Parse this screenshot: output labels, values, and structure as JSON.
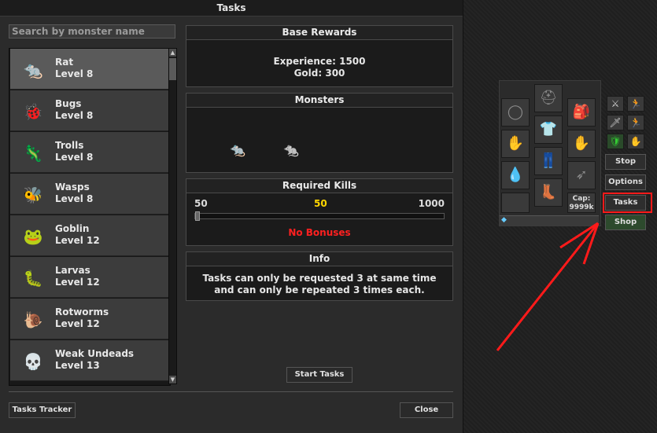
{
  "window": {
    "title": "Tasks"
  },
  "search": {
    "placeholder": "Search by monster name"
  },
  "monsters": [
    {
      "name": "Rat",
      "level": "Level 8",
      "icon": "rat-icon"
    },
    {
      "name": "Bugs",
      "level": "Level 8",
      "icon": "bug-icon"
    },
    {
      "name": "Trolls",
      "level": "Level 8",
      "icon": "troll-icon"
    },
    {
      "name": "Wasps",
      "level": "Level 8",
      "icon": "wasp-icon"
    },
    {
      "name": "Goblin",
      "level": "Level 12",
      "icon": "goblin-icon"
    },
    {
      "name": "Larvas",
      "level": "Level 12",
      "icon": "larva-icon"
    },
    {
      "name": "Rotworms",
      "level": "Level 12",
      "icon": "rotworm-icon"
    },
    {
      "name": "Weak Undeads",
      "level": "Level 13",
      "icon": "skeleton-icon"
    }
  ],
  "base_rewards": {
    "title": "Base Rewards",
    "experience": "Experience: 1500",
    "gold": "Gold: 300"
  },
  "monsters_panel": {
    "title": "Monsters"
  },
  "required_kills": {
    "title": "Required Kills",
    "min": "50",
    "current": "50",
    "max": "1000",
    "bonus": "No Bonuses",
    "slider_fraction": 0
  },
  "info": {
    "title": "Info",
    "text": "Tasks can only be requested 3 at same time and can only be repeated 3 times each."
  },
  "buttons": {
    "start": "Start Tasks",
    "tracker": "Tasks Tracker",
    "close": "Close"
  },
  "side": {
    "cap_label": "Cap:",
    "cap_value": "9999k",
    "stop": "Stop",
    "options": "Options",
    "tasks": "Tasks",
    "shop": "Shop"
  },
  "colors": {
    "highlight": "#ff1a1a",
    "bonus": "#ff2020",
    "current_kills": "#ffd700"
  }
}
